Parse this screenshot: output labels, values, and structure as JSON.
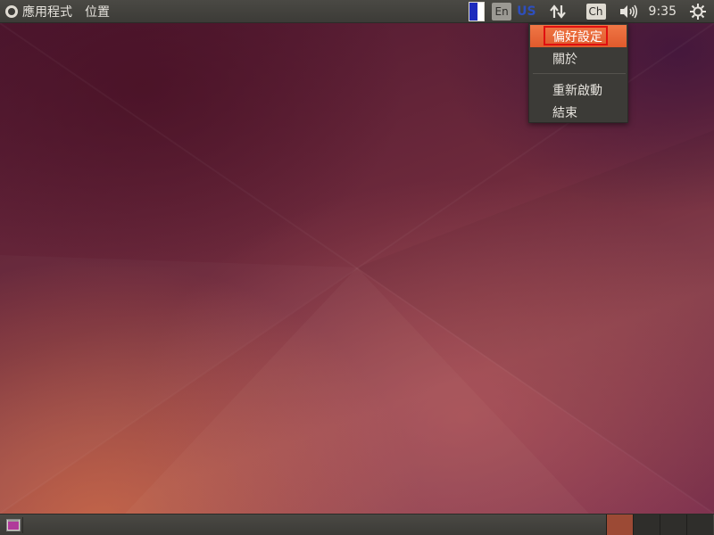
{
  "top_panel": {
    "menus": [
      "應用程式",
      "位置"
    ],
    "keyboard_lang": "En",
    "layout": "US",
    "input_method": "Ch",
    "clock": "9:35"
  },
  "dropdown": {
    "items": [
      {
        "label": "偏好設定",
        "active": true
      },
      {
        "label": "關於",
        "active": false
      },
      {
        "label": "重新啟動",
        "active": false
      },
      {
        "label": "結束",
        "active": false
      }
    ]
  },
  "workspaces": {
    "count": 4,
    "active_index": 0
  },
  "colors": {
    "panel": "#3c3b37",
    "menu_highlight": "#e8683a",
    "active_workspace": "#9c4a35",
    "highlight_outline": "#e01010"
  },
  "icons": [
    "ubuntu-logo-icon",
    "battery-icon",
    "keyboard-icon",
    "network-icon",
    "input-method-icon",
    "volume-icon",
    "power-icon",
    "show-desktop-icon"
  ]
}
